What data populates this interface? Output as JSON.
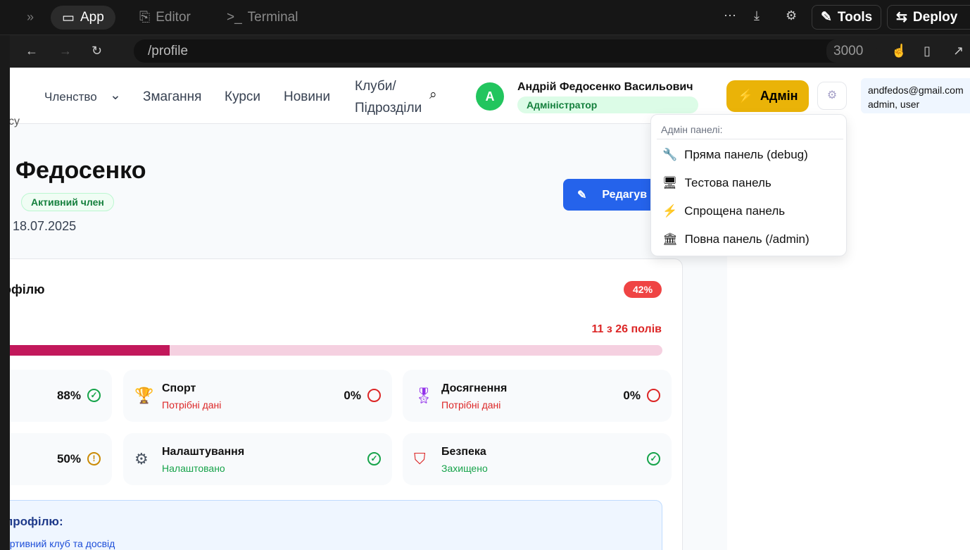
{
  "ide": {
    "tabs": [
      {
        "label": "App",
        "icon": "window-icon"
      },
      {
        "label": "Editor",
        "icon": "file-icon"
      },
      {
        "label": "Terminal",
        "icon": "terminal-icon"
      }
    ],
    "tools": "Tools",
    "deploy": "Deploy",
    "url": "/profile",
    "port": "3000"
  },
  "nav": {
    "items": [
      "Членство",
      "Змагання",
      "Курси",
      "Новини",
      "Клуби/",
      "Підрозділи"
    ]
  },
  "user": {
    "initial": "A",
    "name": "Андрій Федосенко Васильович",
    "role": "Адміністратор",
    "admin_button": "Адмін",
    "email": "andfedos@gmail.com",
    "roles": "admin, user"
  },
  "admin_menu": {
    "header": "Адмін панелі:",
    "items": [
      {
        "icon": "🔧",
        "label": "Пряма панель (debug)"
      },
      {
        "icon": "🖥",
        "label": "Тестова панель"
      },
      {
        "icon": "⚡",
        "label": "Спрощена панель"
      },
      {
        "icon": "🏛",
        "label": "Повна панель (/admin)"
      }
    ]
  },
  "profile": {
    "breadcrumb": "су",
    "name": "Федосенко",
    "status": "Активний член",
    "date": "18.07.2025",
    "edit": "Редагув"
  },
  "completion": {
    "title": "офілю",
    "percent_badge": "42%",
    "fields": "11 з 26 полів",
    "progress": 42,
    "cells": [
      {
        "percent": "88%"
      },
      {
        "title": "Спорт",
        "sub": "Потрібні дані",
        "percent": "0%"
      },
      {
        "title": "Досягнення",
        "sub": "Потрібні дані",
        "percent": "0%"
      },
      {
        "percent": "50%"
      },
      {
        "title": "Налаштування",
        "sub": "Налаштовано"
      },
      {
        "title": "Безпека",
        "sub": "Захищено"
      }
    ],
    "tips_title": "профілю:",
    "tip": "ортивний клуб та досвід"
  },
  "colors": {
    "accent": "#c2185b",
    "admin": "#eab308",
    "edit": "#2563eb"
  }
}
